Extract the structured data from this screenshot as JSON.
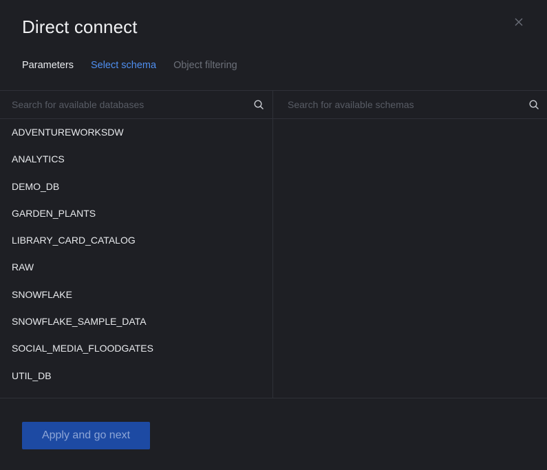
{
  "dialog": {
    "title": "Direct connect",
    "close_icon": "close-icon"
  },
  "tabs": [
    {
      "label": "Parameters",
      "state": "done"
    },
    {
      "label": "Select schema",
      "state": "active"
    },
    {
      "label": "Object filtering",
      "state": "disabled"
    }
  ],
  "databases_panel": {
    "search_placeholder": "Search for available databases",
    "search_value": "",
    "search_icon": "search-icon",
    "items": [
      "ADVENTUREWORKSDW",
      "ANALYTICS",
      "DEMO_DB",
      "GARDEN_PLANTS",
      "LIBRARY_CARD_CATALOG",
      "RAW",
      "SNOWFLAKE",
      "SNOWFLAKE_SAMPLE_DATA",
      "SOCIAL_MEDIA_FLOODGATES",
      "UTIL_DB"
    ]
  },
  "schemas_panel": {
    "search_placeholder": "Search for available schemas",
    "search_value": "",
    "search_icon": "search-icon",
    "items": []
  },
  "footer": {
    "apply_label": "Apply and go next"
  },
  "colors": {
    "background": "#1e1f24",
    "accent": "#4f8ff0",
    "button": "#1d4aa3",
    "border": "#2f3138"
  }
}
